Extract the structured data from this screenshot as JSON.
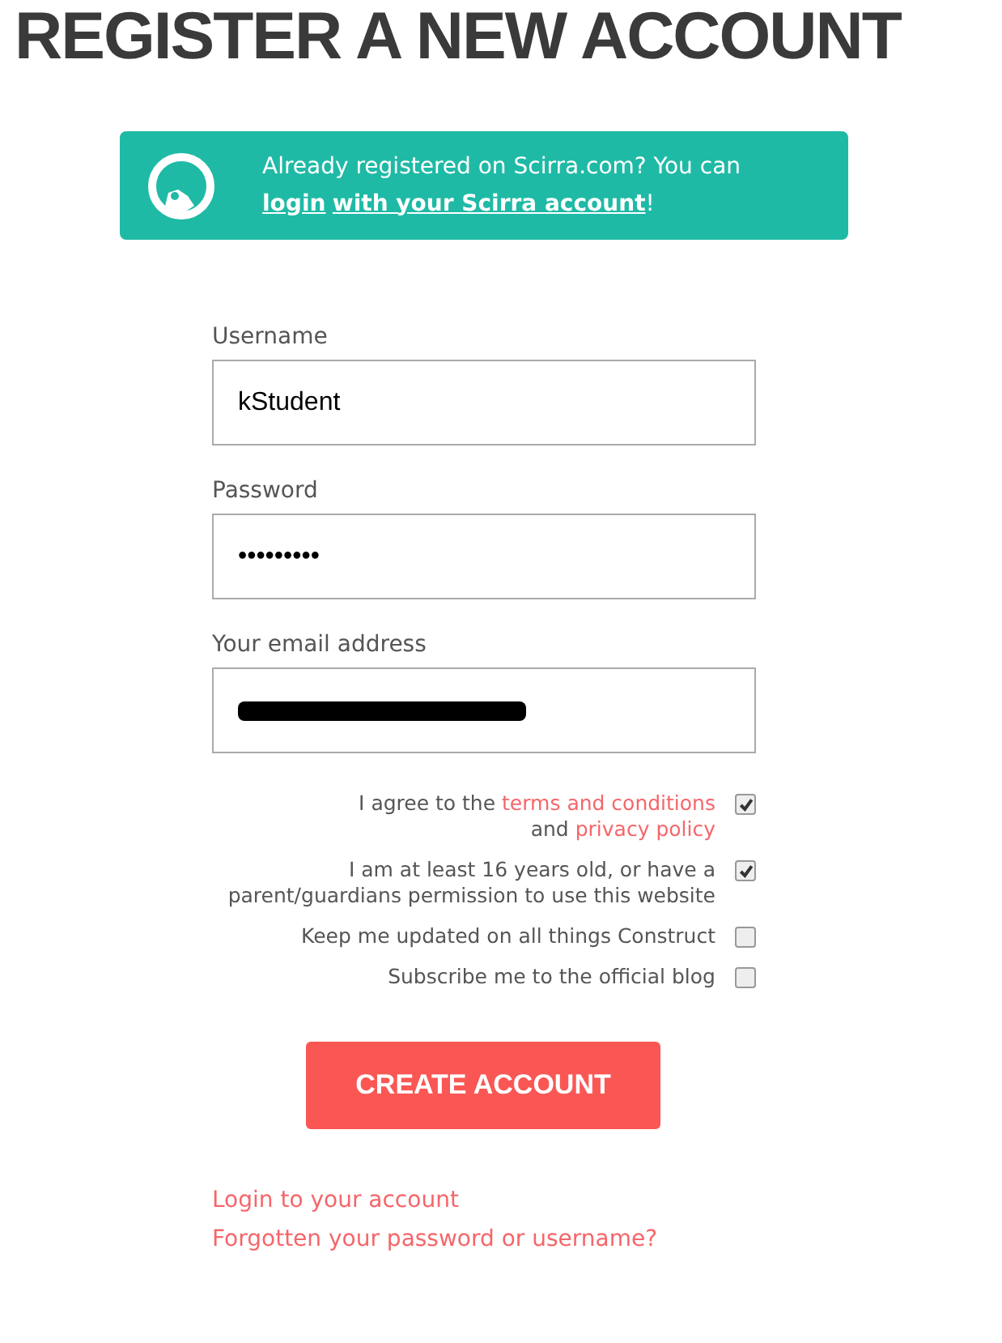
{
  "title": "REGISTER A NEW ACCOUNT",
  "banner": {
    "parts": [
      {
        "kind": "text",
        "text": "Already registered on Scirra.com? You can "
      },
      {
        "kind": "link",
        "text": "login"
      },
      {
        "kind": "link",
        "text": "with your Scirra account"
      },
      {
        "kind": "text",
        "text": "!"
      }
    ]
  },
  "fields": [
    {
      "label": "Username",
      "value": "kStudent",
      "redacted": false
    },
    {
      "label": "Password",
      "value": "•••••••••",
      "redacted": false
    },
    {
      "label": "Your email address",
      "redacted": true
    }
  ],
  "checkboxes": [
    {
      "lines": [
        [
          {
            "kind": "text",
            "text": "I agree to the "
          },
          {
            "kind": "link",
            "text": "terms and conditions"
          }
        ],
        [
          {
            "kind": "text",
            "text": "and "
          },
          {
            "kind": "link",
            "text": "privacy policy"
          }
        ]
      ],
      "checked": true
    },
    {
      "lines": [
        [
          {
            "kind": "text",
            "text": "I am at least 16 years old, or have a"
          }
        ],
        [
          {
            "kind": "text",
            "text": "parent/guardians permission to use this website"
          }
        ]
      ],
      "checked": true
    },
    {
      "lines": [
        [
          {
            "kind": "text",
            "text": "Keep me updated on all things Construct"
          }
        ]
      ],
      "checked": false
    },
    {
      "lines": [
        [
          {
            "kind": "text",
            "text": "Subscribe me to the official blog"
          }
        ]
      ],
      "checked": false
    }
  ],
  "submit": "CREATE ACCOUNT",
  "links": [
    "Login to your account",
    "Forgotten your password or username?"
  ]
}
